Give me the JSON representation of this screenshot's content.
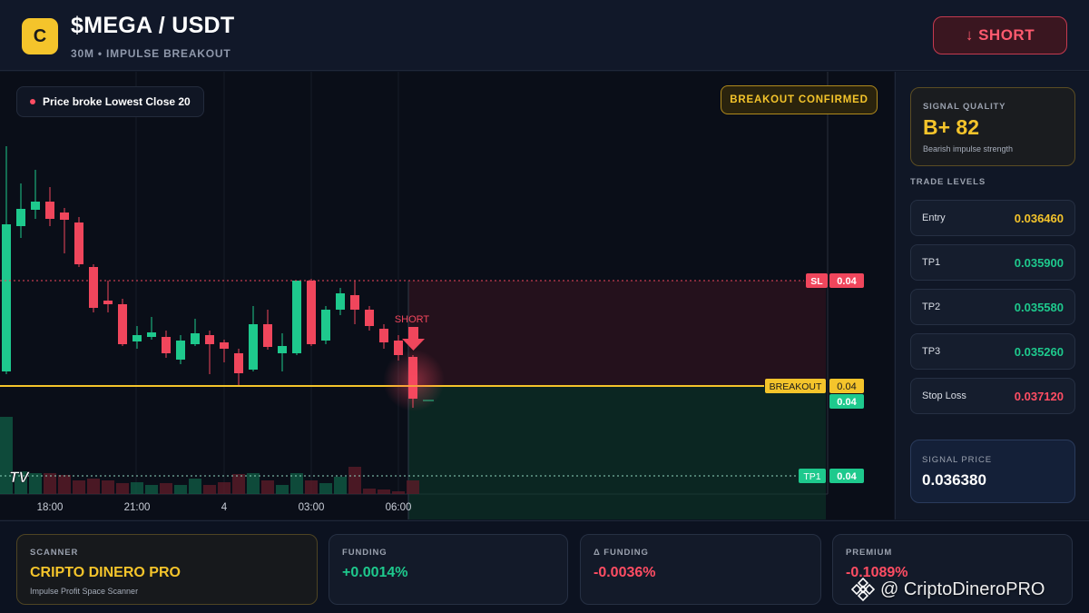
{
  "header": {
    "logo_letter": "C",
    "title": "$MEGA / USDT",
    "subtitle": "30M • IMPULSE BREAKOUT",
    "short_button": "↓ SHORT"
  },
  "chart": {
    "note": "Price broke Lowest Close 20",
    "badge": "BREAKOUT CONFIRMED",
    "signal_marker": "SHORT",
    "time_labels": [
      "18:00",
      "21:00",
      "4",
      "03:00",
      "06:00"
    ],
    "lines": {
      "sl": {
        "tag": "SL",
        "price": "0.04"
      },
      "breakout": {
        "tag": "BREAKOUT",
        "price": "0.04"
      },
      "current": {
        "price": "0.04"
      },
      "tp1": {
        "tag": "TP1",
        "price": "0.04"
      }
    },
    "colors": {
      "up": "#1ec98d",
      "down": "#f0465c",
      "breakout": "#f4c42b",
      "sl": "#f0465c"
    },
    "watermark_logo": "TV"
  },
  "sidebar": {
    "quality": {
      "label": "SIGNAL QUALITY",
      "value": "B+ 82",
      "desc": "Bearish impulse strength"
    },
    "levels_title": "TRADE LEVELS",
    "levels": [
      {
        "name": "Entry",
        "value": "0.036460",
        "color": "#f4c42b"
      },
      {
        "name": "TP1",
        "value": "0.035900",
        "color": "#1ec98d"
      },
      {
        "name": "TP2",
        "value": "0.035580",
        "color": "#1ec98d"
      },
      {
        "name": "TP3",
        "value": "0.035260",
        "color": "#1ec98d"
      },
      {
        "name": "Stop Loss",
        "value": "0.037120",
        "color": "#ff4d63"
      }
    ],
    "signal": {
      "label": "SIGNAL PRICE",
      "value": "0.036380"
    }
  },
  "footer": {
    "scanner": {
      "label": "SCANNER",
      "value": "CRIPTO DINERO PRO",
      "desc": "Impulse Profit Space Scanner"
    },
    "funding": {
      "label": "FUNDING",
      "value": "+0.0014%"
    },
    "delta_funding": {
      "label": "Δ FUNDING",
      "value": "-0.0036%"
    },
    "premium": {
      "label": "PREMIUM",
      "value": "-0.1089%"
    }
  },
  "watermark": {
    "text": "@ CriptoDineroPRO"
  }
}
